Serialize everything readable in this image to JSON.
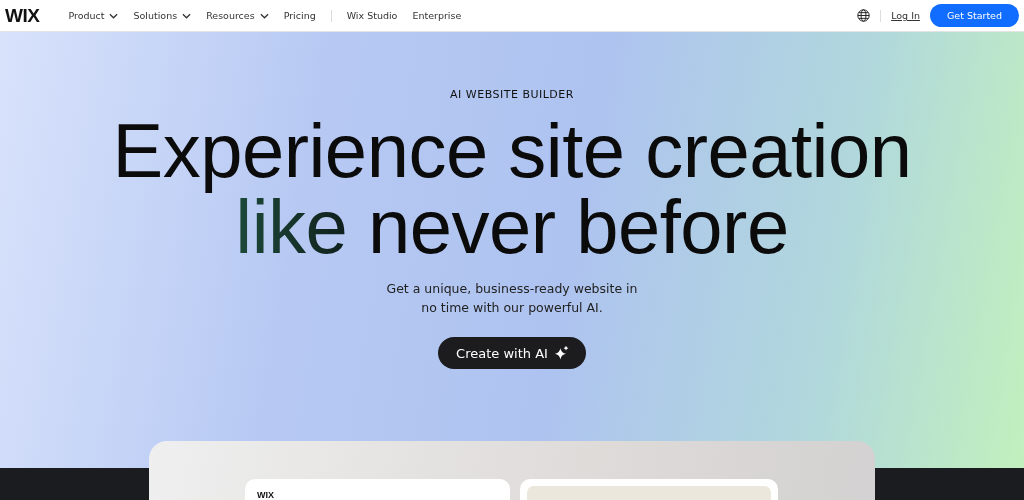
{
  "nav": {
    "logo": "WIX",
    "items": [
      {
        "label": "Product",
        "dropdown": true
      },
      {
        "label": "Solutions",
        "dropdown": true
      },
      {
        "label": "Resources",
        "dropdown": true
      },
      {
        "label": "Pricing",
        "dropdown": false
      }
    ],
    "secondary_items": [
      "Wix Studio",
      "Enterprise"
    ],
    "login": "Log In",
    "cta": "Get Started"
  },
  "hero": {
    "eyebrow": "AI WEBSITE BUILDER",
    "headline_line_1": "Experience site creation",
    "headline_accent": "like",
    "headline_line_2": "never before",
    "subtitle": "Get a unique, business-ready website in no time with our powerful AI.",
    "button": "Create with AI"
  },
  "preview": {
    "left_card_logo": "WIX"
  }
}
